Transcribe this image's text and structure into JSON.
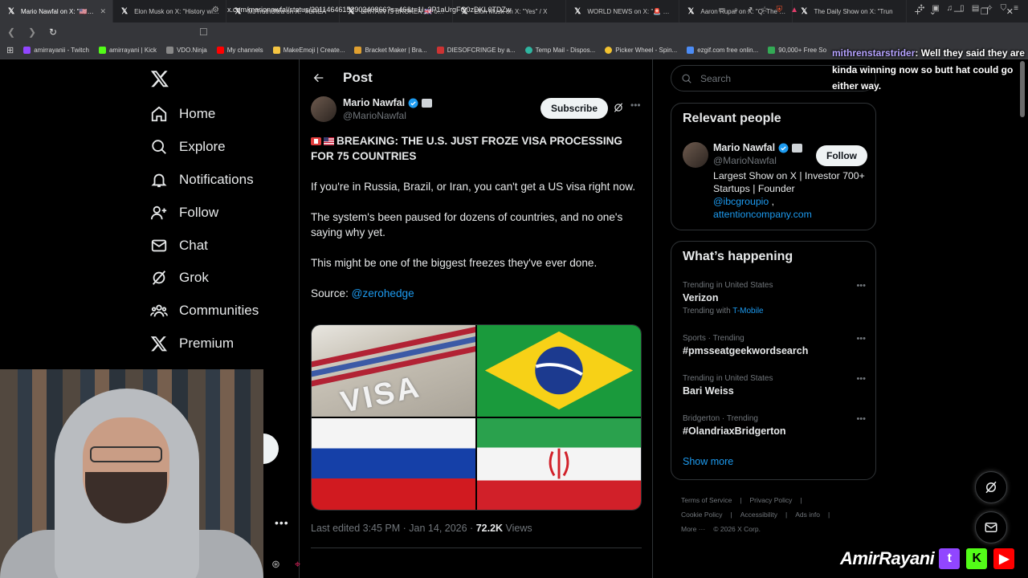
{
  "browser": {
    "tabs": [
      {
        "title": "Mario Nawfal on X: \"🇺🇸 us",
        "favicon": "X"
      },
      {
        "title": "Elon Musk on X: \"History will n",
        "favicon": "X"
      },
      {
        "title": "MJTruthUltra on X: \"#BREA",
        "favicon": "X"
      },
      {
        "title": "BRITAIN IS BROKEN 🇬🇧 on X: \"",
        "favicon": "X"
      },
      {
        "title": "Elon Musk on X: \"Yes\" / X",
        "favicon": "X"
      },
      {
        "title": "WORLD NEWS on X: \"🚨 JUST",
        "favicon": "X"
      },
      {
        "title": "Aaron Rupar on X: \"Q: The pre",
        "favicon": "X"
      },
      {
        "title": "The Daily Show on X: \"Trun",
        "favicon": "X"
      }
    ],
    "url": "x.com/marionawfal/status/2011464615390240866?s=46&t=1I_3P1aUrgFQ0zDKL0TDZw",
    "bookmarks": [
      {
        "label": "amirrayanii - Twitch",
        "color": "#9146ff"
      },
      {
        "label": "amirrayani | Kick",
        "color": "#53fc18"
      },
      {
        "label": "VDO.Ninja",
        "color": "#888888"
      },
      {
        "label": "My channels",
        "color": "#ff0000"
      },
      {
        "label": "MakeEmoji | Create...",
        "color": "#f5c542"
      },
      {
        "label": "Bracket Maker | Bra...",
        "color": "#e0a030"
      },
      {
        "label": "DIESOFCRINGE by a...",
        "color": "#cc3333"
      },
      {
        "label": "Temp Mail - Dispos...",
        "color": "#2fb5a0"
      },
      {
        "label": "Picker Wheel - Spin...",
        "color": "#f2c230"
      },
      {
        "label": "ezgif.com free onlin...",
        "color": "#4c8cf5"
      },
      {
        "label": "90,000+ Free So",
        "color": "#33aa55"
      }
    ]
  },
  "nav": {
    "items": [
      {
        "label": "Home",
        "icon": "home-icon"
      },
      {
        "label": "Explore",
        "icon": "search-icon"
      },
      {
        "label": "Notifications",
        "icon": "bell-icon"
      },
      {
        "label": "Follow",
        "icon": "follow-icon"
      },
      {
        "label": "Chat",
        "icon": "mail-icon"
      },
      {
        "label": "Grok",
        "icon": "grok-icon"
      },
      {
        "label": "Communities",
        "icon": "communities-icon"
      },
      {
        "label": "Premium",
        "icon": "x-icon"
      }
    ]
  },
  "post": {
    "header": "Post",
    "author_name": "Mario Nawfal",
    "author_handle": "@MarioNawfal",
    "subscribe_label": "Subscribe",
    "headline": "BREAKING: THE U.S. JUST FROZE VISA PROCESSING FOR 75 COUNTRIES",
    "para1": "If you're in Russia, Brazil, or Iran, you can't get a US visa right now.",
    "para2": "The system's been paused for dozens of countries, and no one's saying why yet.",
    "para3": "This might be one of the biggest freezes they've ever done.",
    "source_label": "Source: ",
    "source_link": "@zerohedge",
    "visa_word": "VISA",
    "meta_time": "Last edited 3:45 PM · Jan 14, 2026 · ",
    "meta_views": "72.2K",
    "meta_views_label": " Views"
  },
  "sidebar": {
    "search_placeholder": "Search",
    "relevant_title": "Relevant people",
    "person_name": "Mario Nawfal",
    "person_handle": "@MarioNawfal",
    "person_bio": "Largest Show on X | Investor 700+ Startups | Founder",
    "person_link1": "@ibcgroupio",
    "person_link1_suffix": " ,",
    "person_link2": "attentioncompany.com",
    "follow_label": "Follow",
    "happening_title": "What’s happening",
    "trends": [
      {
        "category": "Trending in United States",
        "name": "Verizon",
        "with_label": "Trending with ",
        "with_link": "T-Mobile"
      },
      {
        "category": "Sports · Trending",
        "name": "#pmsseatgeekwordsearch"
      },
      {
        "category": "Trending in United States",
        "name": "Bari Weiss"
      },
      {
        "category": "Bridgerton · Trending",
        "name": "#OlandriaxBridgerton"
      }
    ],
    "show_more": "Show more",
    "footer": [
      "Terms of Service",
      "|",
      "Privacy Policy",
      "|",
      "Cookie Policy",
      "|",
      "Accessibility",
      "|",
      "Ads info",
      "|",
      "More ···",
      "© 2026 X Corp."
    ]
  },
  "chat_overlay": {
    "user": "mithrenstarstrider",
    "message": ": Well they said they are kinda winning now so butt hat could go either way."
  },
  "branding": {
    "name": "AmirRayani",
    "twitch_letter": "t",
    "kick_letter": "K"
  },
  "colors": {
    "accent": "#1d9bf0",
    "background": "#000000",
    "border": "#2f3336",
    "muted": "#71767b"
  }
}
